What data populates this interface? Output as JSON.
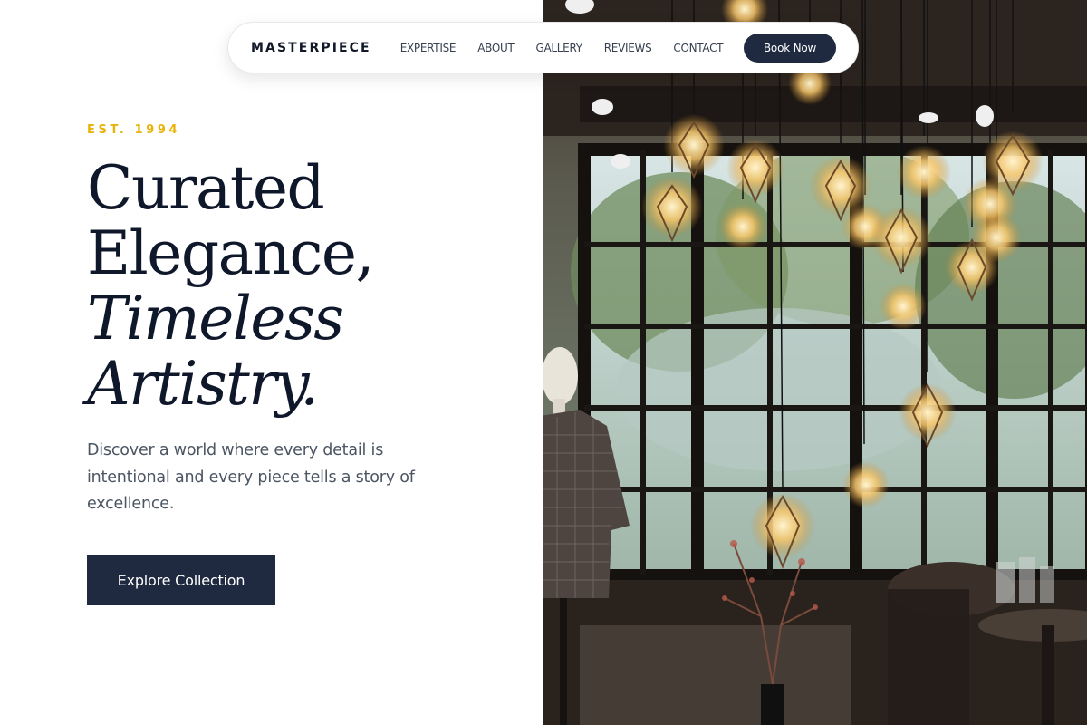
{
  "nav": {
    "brand": "MASTERPIECE",
    "links": [
      "EXPERTISE",
      "ABOUT",
      "GALLERY",
      "REVIEWS",
      "CONTACT"
    ],
    "cta_label": "Book Now"
  },
  "hero": {
    "eyebrow": "EST. 1994",
    "headline": {
      "line1": "Curated",
      "line2": "Elegance,",
      "line3": "Timeless",
      "line4": "Artistry."
    },
    "lead": "Discover a world where every detail is intentional and every piece tells a story of excellence.",
    "cta_label": "Explore Collection"
  },
  "colors": {
    "accent_gold": "#eab308",
    "navy": "#1f2a40",
    "headline": "#0f172a",
    "body_text": "#4b5563"
  }
}
